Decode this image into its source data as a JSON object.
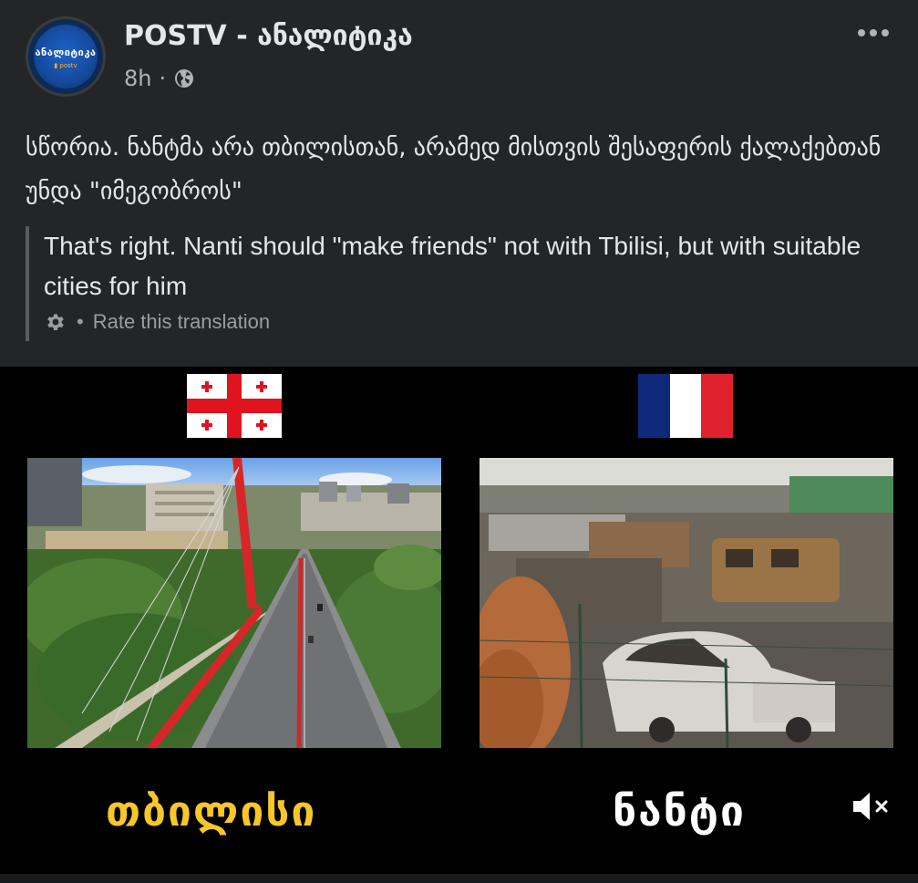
{
  "header": {
    "page_name": "POSTV - ანალიტიკა",
    "time": "8h",
    "separator": "·",
    "privacy_icon": "globe-icon",
    "more_icon": "more-horizontal-icon"
  },
  "avatar": {
    "logo_text": "ანალიტიკა",
    "logo_sub": "▮ postv"
  },
  "post": {
    "text": "სწორია. ნანტმა არა თბილისთან, არამედ მისთვის შესაფერის ქალაქებთან უნდა \"იმეგობროს\""
  },
  "translation": {
    "text": "That's right. Nanti should \"make friends\" not with Tbilisi, but with suitable cities for him",
    "settings_icon": "gear-icon",
    "separator": "•",
    "rate_label": "Rate this translation"
  },
  "media": {
    "left_flag": "georgia-flag",
    "right_flag": "france-flag",
    "left_caption": "თბილისი",
    "right_caption": "ნანტი",
    "mute_icon": "volume-muted-icon",
    "colors": {
      "left_caption": "#f7c62b",
      "right_caption": "#ffffff",
      "france_blue": "#0f2a7a",
      "france_red": "#e0222e"
    }
  }
}
